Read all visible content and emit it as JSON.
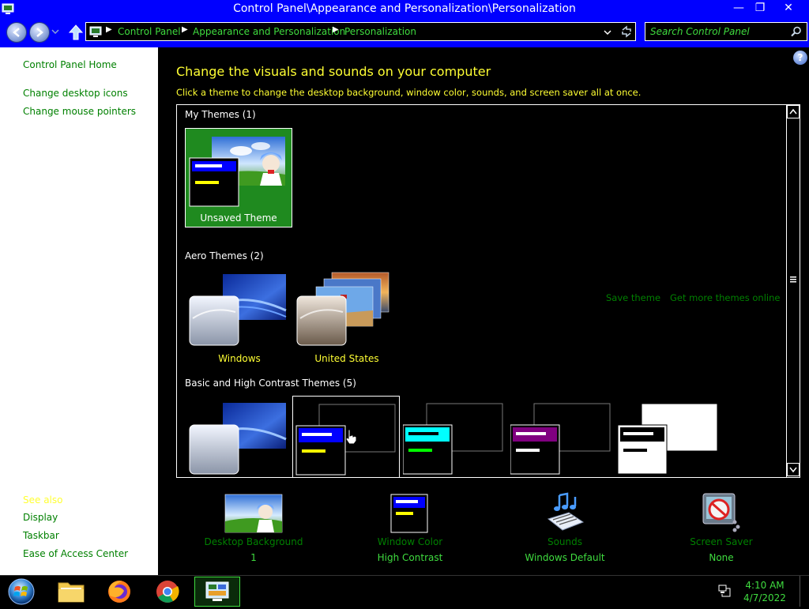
{
  "window": {
    "title": "Control Panel\\Appearance and Personalization\\Personalization",
    "minimize": "—",
    "restore": "❐",
    "close": "✕"
  },
  "address": {
    "crumbs": [
      "Control Panel",
      "Appearance and Personalization",
      "Personalization"
    ],
    "search_placeholder": "Search Control Panel"
  },
  "sidebar": {
    "links": [
      "Control Panel Home",
      "Change desktop icons",
      "Change mouse pointers"
    ],
    "see_also": "See also",
    "bottom_links": [
      "Display",
      "Taskbar",
      "Ease of Access Center"
    ]
  },
  "main": {
    "help": "?",
    "heading": "Change the visuals and sounds on your computer",
    "subheading": "Click a theme to change the desktop background, window color, sounds, and screen saver all at once.",
    "groups": {
      "my_themes": "My Themes (1)",
      "aero_themes": "Aero Themes (2)",
      "basic_themes": "Basic and High Contrast Themes (5)"
    },
    "themes": {
      "unsaved": "Unsaved Theme",
      "windows": "Windows",
      "united_states": "United States"
    },
    "save_theme": "Save theme",
    "get_more": "Get more themes online",
    "bottom": [
      {
        "label": "Desktop Background",
        "value": "1"
      },
      {
        "label": "Window Color",
        "value": "High Contrast"
      },
      {
        "label": "Sounds",
        "value": "Windows Default"
      },
      {
        "label": "Screen Saver",
        "value": "None"
      }
    ]
  },
  "taskbar": {
    "time": "4:10 AM",
    "date": "4/7/2022"
  },
  "colors": {
    "accent": "#0000ff",
    "link": "#008000",
    "highlight_text": "#ffff33",
    "bright_green": "#3fdc3f"
  }
}
